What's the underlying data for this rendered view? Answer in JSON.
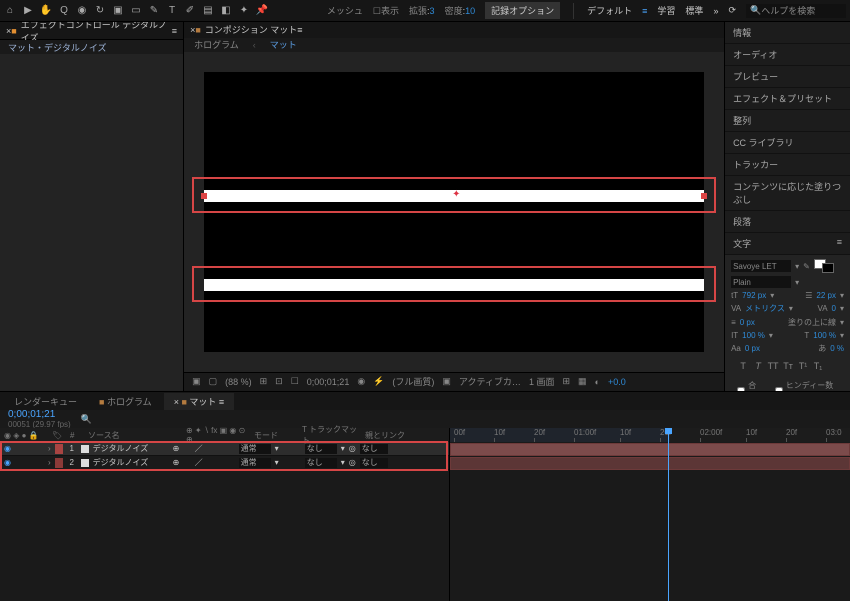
{
  "toolbar": {
    "mesh": "メッシュ",
    "show": "表示",
    "expand": "拡張",
    "expand_val": "3",
    "density": "密度",
    "density_val": "10",
    "rec": "記録オプション",
    "default": "デフォルト",
    "learn": "学習",
    "standard": "標準",
    "search": "ヘルプを検索"
  },
  "effect_panel": {
    "title": "エフェクトコントロール デジタルノイズ",
    "breadcrumb": "マット・デジタルノイズ"
  },
  "comp": {
    "title": "コンポジション マット",
    "t1": "ホログラム",
    "t2": "マット"
  },
  "viewer_footer": {
    "zoom": "(88 %)",
    "time": "0;00;01;21",
    "quality": "(フル画質)",
    "camera": "アクティブカ…",
    "views": "1 画面",
    "exp": "+0.0"
  },
  "right_panels": {
    "p1": "情報",
    "p2": "オーディオ",
    "p3": "プレビュー",
    "p4": "エフェクト＆プリセット",
    "p5": "整列",
    "p6": "CC ライブラリ",
    "p7": "トラッカー",
    "p8": "コンテンツに応じた塗りつぶし",
    "p9": "段落",
    "p10": "文字"
  },
  "char": {
    "font": "Savoye LET",
    "style": "Plain",
    "size": "792 px",
    "leading": "22 px",
    "metrics": "メトリクス",
    "tracking": "0",
    "stroke": "0 px",
    "stroke_opt": "塗りの上に線",
    "vscale": "100 %",
    "hscale": "100 %",
    "baseline": "0 px",
    "tsume": "0 %",
    "ligature": "合字",
    "hindi": "ヒンディー数字"
  },
  "timeline": {
    "tabs": {
      "render": "レンダーキュー",
      "holo": "ホログラム",
      "mat": "マット"
    },
    "timecode": "0;00;01;21",
    "framerate": "00051 (29.97 fps)",
    "col_num": "#",
    "col_src": "ソース名",
    "col_mode": "モード",
    "col_trk": "T  トラックマット",
    "col_parent": "親とリンク",
    "layers": [
      {
        "num": "1",
        "name": "デジタルノイズ",
        "mode": "通常",
        "trk": "なし",
        "parent": "なし"
      },
      {
        "num": "2",
        "name": "デジタルノイズ",
        "mode": "通常",
        "trk": "なし",
        "parent": "なし"
      }
    ],
    "ruler": [
      "00f",
      "10f",
      "20f",
      "01:00f",
      "10f",
      "20f",
      "02:00f",
      "10f",
      "20f",
      "03:0"
    ]
  }
}
